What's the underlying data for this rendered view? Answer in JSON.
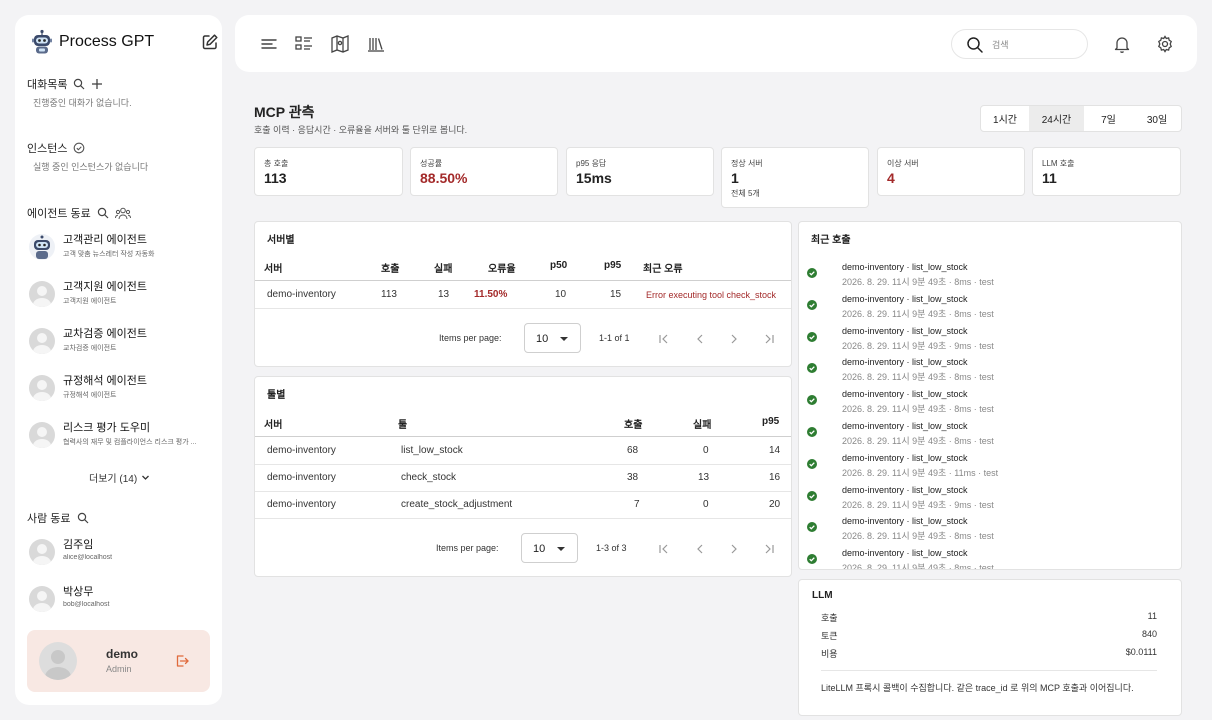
{
  "app": {
    "title": "Process GPT"
  },
  "sidebar": {
    "conversations": {
      "title": "대화목록",
      "empty": "진행중인 대화가 없습니다."
    },
    "instances": {
      "title": "인스턴스",
      "empty": "실행 중인 인스턴스가 없습니다"
    },
    "agents": {
      "title": "에이전트 동료",
      "items": [
        {
          "name": "고객관리 에이전트",
          "desc": "고객 맞춤 뉴스레터 작성 자동화"
        },
        {
          "name": "고객지원 에이전트",
          "desc": "고객지원 에이전트"
        },
        {
          "name": "교차검증 에이전트",
          "desc": "교차검증 에이전트"
        },
        {
          "name": "규정해석 에이전트",
          "desc": "규정해석 에이전트"
        },
        {
          "name": "리스크 평가 도우미",
          "desc": "협력사의 재무 및 컴플라이언스 리스크 평가 ..."
        }
      ],
      "more_label": "더보기 (14)"
    },
    "people": {
      "title": "사람 동료",
      "items": [
        {
          "name": "김주임",
          "email": "alice@localhost"
        },
        {
          "name": "박상무",
          "email": "bob@localhost"
        }
      ]
    },
    "current_user": {
      "name": "demo",
      "role": "Admin"
    }
  },
  "topbar": {
    "search_placeholder": "검색",
    "icons": [
      "menu-icon",
      "list-icon",
      "map-icon",
      "library-icon",
      "bell-icon",
      "gear-icon"
    ]
  },
  "main": {
    "title": "MCP 관측",
    "subtitle": "호출 이력 · 응답시간 · 오류율을 서버와 툴 단위로 봅니다.",
    "ranges": [
      {
        "label": "1시간",
        "active": false
      },
      {
        "label": "24시간",
        "active": true
      },
      {
        "label": "7일",
        "active": false
      },
      {
        "label": "30일",
        "active": false
      }
    ],
    "stats": [
      {
        "label": "총 호출",
        "value": "113",
        "alert": false,
        "extra": ""
      },
      {
        "label": "성공률",
        "value": "88.50%",
        "alert": true,
        "extra": ""
      },
      {
        "label": "p95 응답",
        "value": "15ms",
        "alert": false,
        "extra": ""
      },
      {
        "label": "정상 서버",
        "value": "1",
        "alert": false,
        "extra": "전체 5개"
      },
      {
        "label": "이상 서버",
        "value": "4",
        "alert": true,
        "extra": ""
      },
      {
        "label": "LLM 호출",
        "value": "11",
        "alert": false,
        "extra": ""
      }
    ],
    "server_table": {
      "title": "서버별",
      "headers": [
        "서버",
        "호출",
        "실패",
        "오류율",
        "p50",
        "p95",
        "최근 오류"
      ],
      "rows": [
        {
          "server": "demo-inventory",
          "calls": "113",
          "fail": "13",
          "error_rate": "11.50%",
          "p50": "10",
          "p95": "15",
          "recent_error": "Error executing tool check_stock"
        }
      ],
      "per_page_label": "Items per page:",
      "per_page": "10",
      "range_text": "1-1 of 1"
    },
    "tool_table": {
      "title": "툴별",
      "headers": [
        "서버",
        "툴",
        "호출",
        "실패",
        "p95"
      ],
      "rows": [
        {
          "server": "demo-inventory",
          "tool": "list_low_stock",
          "calls": "68",
          "fail": "0",
          "p95": "14"
        },
        {
          "server": "demo-inventory",
          "tool": "check_stock",
          "calls": "38",
          "fail": "13",
          "p95": "16"
        },
        {
          "server": "demo-inventory",
          "tool": "create_stock_adjustment",
          "calls": "7",
          "fail": "0",
          "p95": "20"
        }
      ],
      "per_page_label": "Items per page:",
      "per_page": "10",
      "range_text": "1-3 of 3"
    },
    "recent_calls": {
      "title": "최근 호출",
      "items": [
        {
          "name": "demo-inventory · list_low_stock",
          "meta": "2026. 8. 29. 11시 9분 49초 · 8ms · test"
        },
        {
          "name": "demo-inventory · list_low_stock",
          "meta": "2026. 8. 29. 11시 9분 49초 · 8ms · test"
        },
        {
          "name": "demo-inventory · list_low_stock",
          "meta": "2026. 8. 29. 11시 9분 49초 · 9ms · test"
        },
        {
          "name": "demo-inventory · list_low_stock",
          "meta": "2026. 8. 29. 11시 9분 49초 · 8ms · test"
        },
        {
          "name": "demo-inventory · list_low_stock",
          "meta": "2026. 8. 29. 11시 9분 49초 · 8ms · test"
        },
        {
          "name": "demo-inventory · list_low_stock",
          "meta": "2026. 8. 29. 11시 9분 49초 · 8ms · test"
        },
        {
          "name": "demo-inventory · list_low_stock",
          "meta": "2026. 8. 29. 11시 9분 49초 · 11ms · test"
        },
        {
          "name": "demo-inventory · list_low_stock",
          "meta": "2026. 8. 29. 11시 9분 49초 · 9ms · test"
        },
        {
          "name": "demo-inventory · list_low_stock",
          "meta": "2026. 8. 29. 11시 9분 49초 · 8ms · test"
        },
        {
          "name": "demo-inventory · list_low_stock",
          "meta": "2026. 8. 29. 11시 9분 49초 · 8ms · test"
        }
      ]
    },
    "llm": {
      "title": "LLM",
      "rows": [
        {
          "key": "호출",
          "value": "11"
        },
        {
          "key": "토큰",
          "value": "840"
        },
        {
          "key": "비용",
          "value": "$0.0111"
        }
      ],
      "note": "LiteLLM 프록시 콜백이 수집합니다. 같은 trace_id 로 위의 MCP 호출과 이어집니다."
    }
  },
  "colors": {
    "alert": "#a32a2a",
    "success": "#2e7d32",
    "user_box": "#f8e8e3",
    "logout": "#e06a3c"
  }
}
